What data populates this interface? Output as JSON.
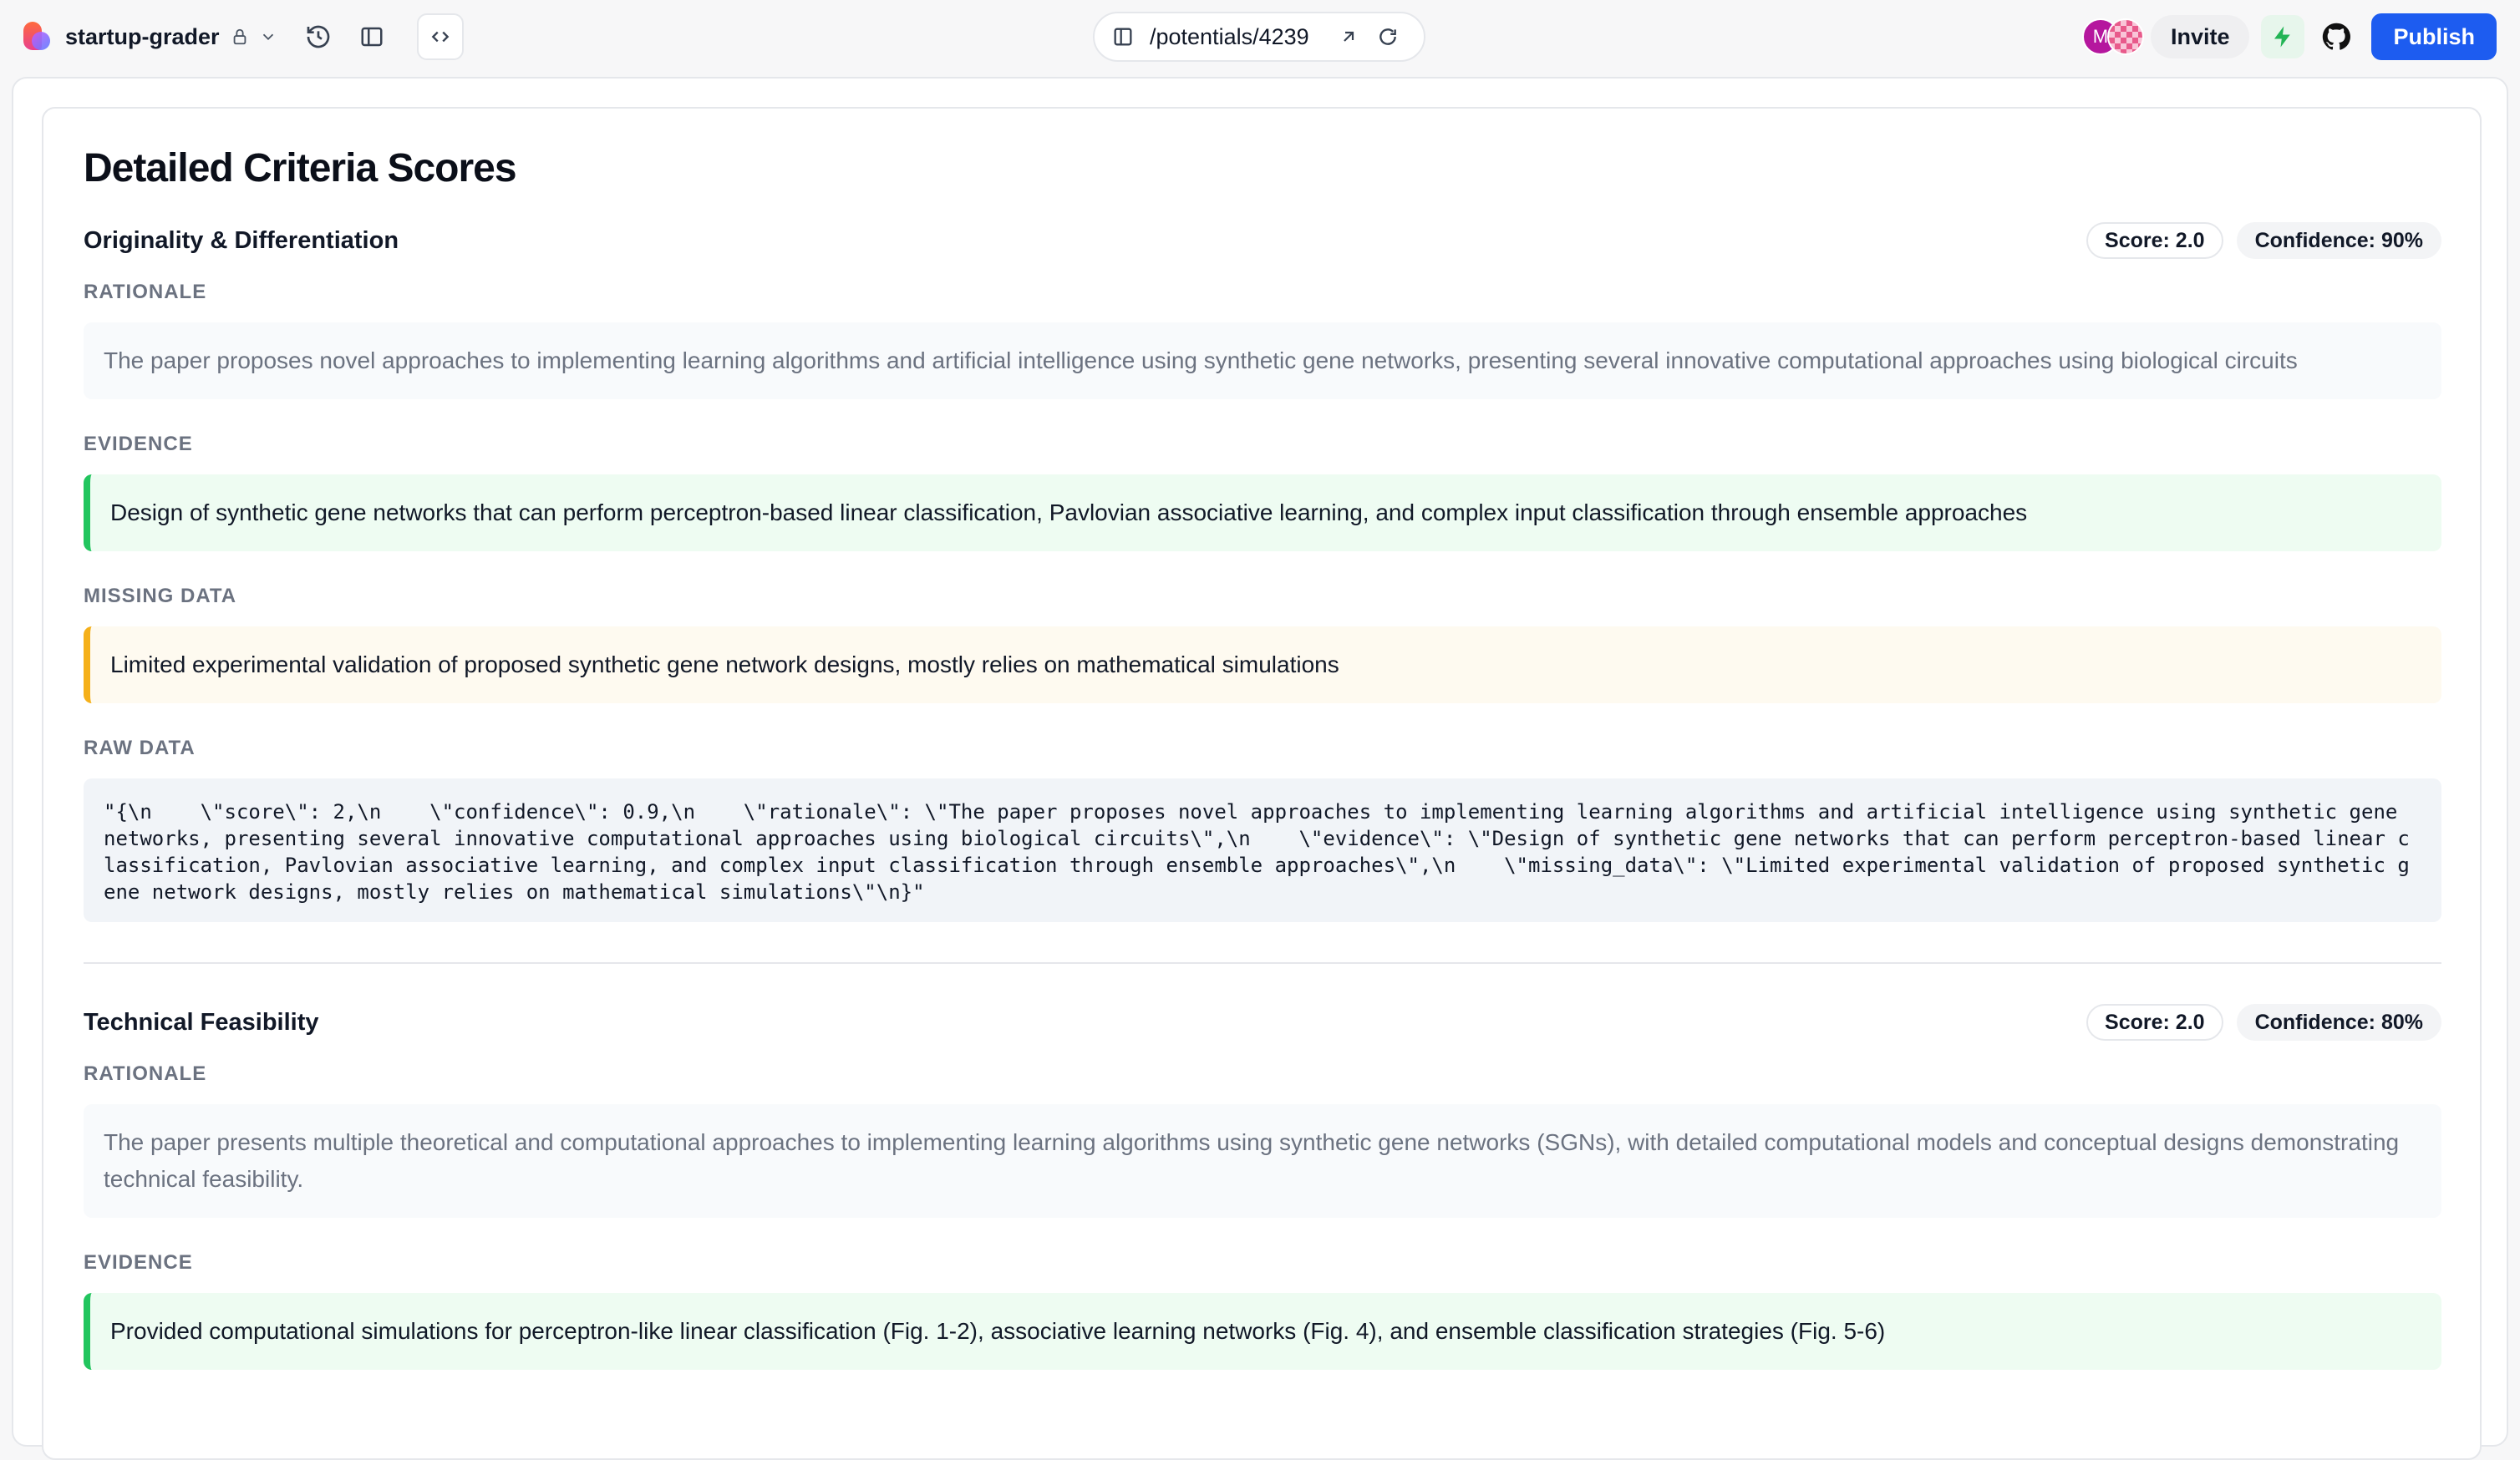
{
  "topbar": {
    "project_name": "startup-grader",
    "url_path": "/potentials/4239",
    "avatar_initial": "M",
    "invite_label": "Invite",
    "publish_label": "Publish"
  },
  "page": {
    "title": "Detailed Criteria Scores"
  },
  "labels": {
    "rationale": "RATIONALE",
    "evidence": "EVIDENCE",
    "missing": "MISSING DATA",
    "raw": "RAW DATA"
  },
  "criteria": [
    {
      "name": "Originality & Differentiation",
      "score": "Score: 2.0",
      "confidence": "Confidence: 90%",
      "rationale": "The paper proposes novel approaches to implementing learning algorithms and artificial intelligence using synthetic gene networks, presenting several innovative computational approaches using biological circuits",
      "evidence": "Design of synthetic gene networks that can perform perceptron-based linear classification, Pavlovian associative learning, and complex input classification through ensemble approaches",
      "missing_data": "Limited experimental validation of proposed synthetic gene network designs, mostly relies on mathematical simulations",
      "raw_data": "\"{\\n    \\\"score\\\": 2,\\n    \\\"confidence\\\": 0.9,\\n    \\\"rationale\\\": \\\"The paper proposes novel approaches to implementing learning algorithms and artificial intelligence using synthetic gene networks, presenting several innovative computational approaches using biological circuits\\\",\\n    \\\"evidence\\\": \\\"Design of synthetic gene networks that can perform perceptron-based linear classification, Pavlovian associative learning, and complex input classification through ensemble approaches\\\",\\n    \\\"missing_data\\\": \\\"Limited experimental validation of proposed synthetic gene network designs, mostly relies on mathematical simulations\\\"\\n}\""
    },
    {
      "name": "Technical Feasibility",
      "score": "Score: 2.0",
      "confidence": "Confidence: 80%",
      "rationale": "The paper presents multiple theoretical and computational approaches to implementing learning algorithms using synthetic gene networks (SGNs), with detailed computational models and conceptual designs demonstrating technical feasibility.",
      "evidence": "Provided computational simulations for perceptron-like linear classification (Fig. 1-2), associative learning networks (Fig. 4), and ensemble classification strategies (Fig. 5-6)"
    }
  ],
  "colors": {
    "publish": "#1d5cf0",
    "evidence_bar": "#22c55e",
    "missing_bar": "#f5b01a"
  }
}
